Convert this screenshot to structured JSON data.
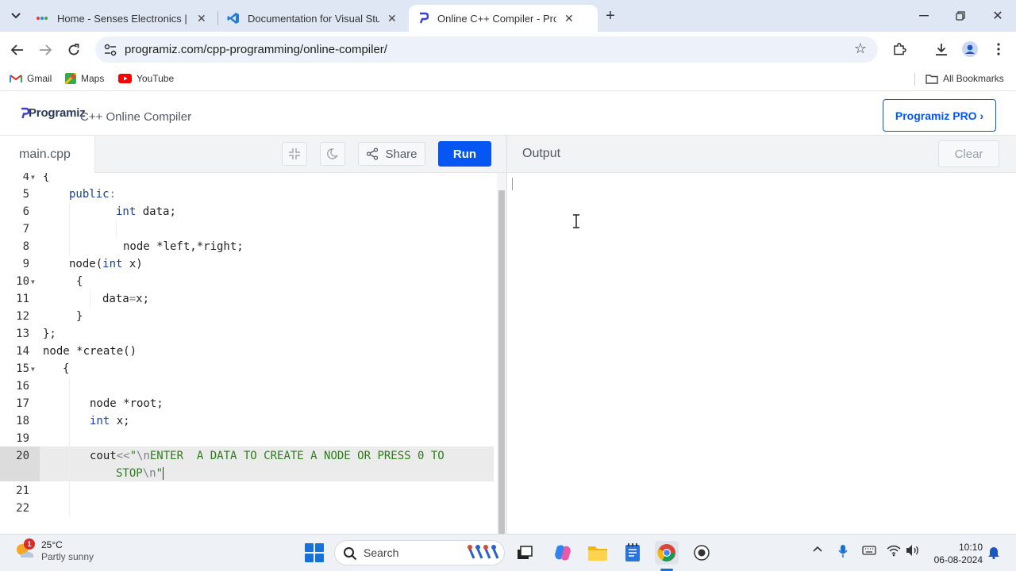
{
  "browser": {
    "tabs": [
      {
        "title": "Home - Senses Electronics | Int"
      },
      {
        "title": "Documentation for Visual Studi"
      },
      {
        "title": "Online C++ Compiler - Progra"
      }
    ],
    "url": "programiz.com/cpp-programming/online-compiler/",
    "bookmarks": [
      {
        "label": "Gmail"
      },
      {
        "label": "Maps"
      },
      {
        "label": "YouTube"
      }
    ],
    "all_bookmarks": "All Bookmarks"
  },
  "site": {
    "logo": "Programiz",
    "title": "C++ Online Compiler",
    "pro_button": "Programiz PRO ›",
    "accent": "#0556f3"
  },
  "editor": {
    "file_name": "main.cpp",
    "share_label": "Share",
    "run_label": "Run",
    "lines": [
      {
        "n": "4",
        "fold": true
      },
      {
        "n": "5"
      },
      {
        "n": "6"
      },
      {
        "n": "7"
      },
      {
        "n": "8"
      },
      {
        "n": "9"
      },
      {
        "n": "10",
        "fold": true
      },
      {
        "n": "11"
      },
      {
        "n": "12"
      },
      {
        "n": "13"
      },
      {
        "n": "14"
      },
      {
        "n": "15",
        "fold": true
      },
      {
        "n": "16"
      },
      {
        "n": "17"
      },
      {
        "n": "18"
      },
      {
        "n": "19"
      },
      {
        "n": "20"
      },
      {
        "n": "21"
      },
      {
        "n": "22"
      }
    ],
    "code": {
      "l4": "{",
      "l5_kw": "public",
      "l5_op": ":",
      "l6_kw": "int",
      "l6_rest": " data;",
      "l8": "node *left,*right;",
      "l9_a": "node(",
      "l9_kw": "int",
      "l9_b": " x)",
      "l10": "{",
      "l11_a": "data",
      "l11_op": "=",
      "l11_b": "x;",
      "l12": "}",
      "l13": "};",
      "l14": "node *create()",
      "l15": "{",
      "l17": "node *root;",
      "l18_kw": "int",
      "l18_rest": " x;",
      "l20_a": "cout",
      "l20_op": "<<",
      "l20_q": "\"",
      "l20_esc1": "\\n",
      "l20_str": "ENTER  A DATA TO CREATE A NODE OR PRESS 0 TO",
      "l20w_str": "STOP",
      "l20w_esc": "\\n",
      "l20w_q": "\""
    }
  },
  "output": {
    "title": "Output",
    "clear_label": "Clear"
  },
  "taskbar": {
    "temperature": "25°C",
    "weather": "Partly sunny",
    "weather_badge": "1",
    "search_label": "Search",
    "time": "10:10",
    "date": "06-08-2024"
  }
}
